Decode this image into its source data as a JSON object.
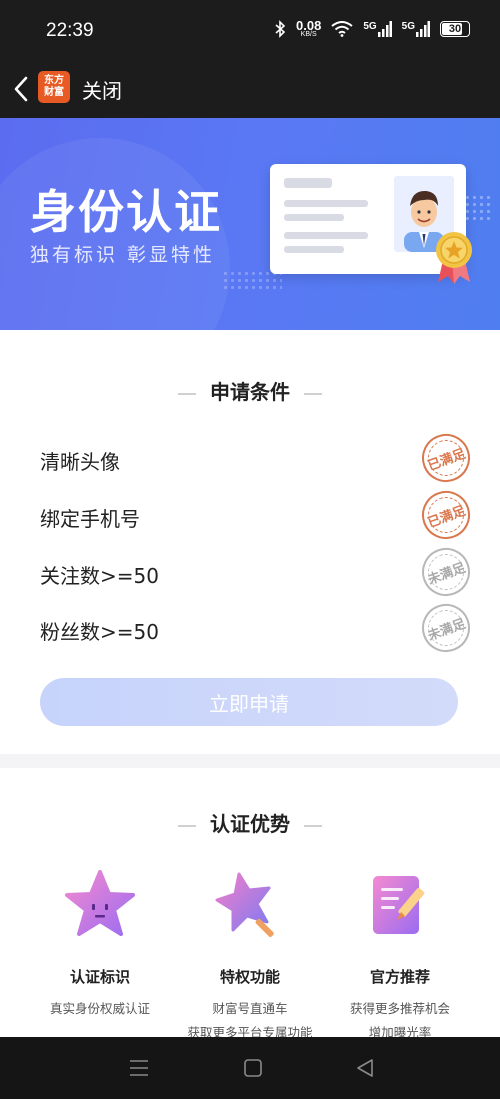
{
  "status_bar": {
    "time": "22:39",
    "net_speed_value": "0.08",
    "net_speed_unit": "KB/S",
    "sim1_label": "5G",
    "sim2_label": "5G",
    "battery": "30"
  },
  "app_bar": {
    "logo_text_line1": "东方",
    "logo_text_line2": "财富",
    "close_label": "关闭"
  },
  "banner": {
    "title": "身份认证",
    "subtitle": "独有标识 彰显特性"
  },
  "conditions": {
    "heading": "申请条件",
    "items": [
      {
        "label": "清晰头像",
        "status": "已满足",
        "met": true
      },
      {
        "label": "绑定手机号",
        "status": "已满足",
        "met": true
      },
      {
        "label": "关注数>=50",
        "status": "未满足",
        "met": false
      },
      {
        "label": "粉丝数>=50",
        "status": "未满足",
        "met": false
      }
    ],
    "apply_button": "立即申请"
  },
  "advantages": {
    "heading": "认证优势",
    "items": [
      {
        "title": "认证标识",
        "desc1": "真实身份权威认证",
        "desc2": ""
      },
      {
        "title": "特权功能",
        "desc1": "财富号直通车",
        "desc2": "获取更多平台专属功能"
      },
      {
        "title": "官方推荐",
        "desc1": "获得更多推荐机会",
        "desc2": "增加曝光率"
      }
    ]
  },
  "colors": {
    "banner_blue": "#5a78f4",
    "stamp_met": "#d9784e",
    "stamp_unmet": "#b8b8b8",
    "button_disabled": "#c6d3fb"
  }
}
